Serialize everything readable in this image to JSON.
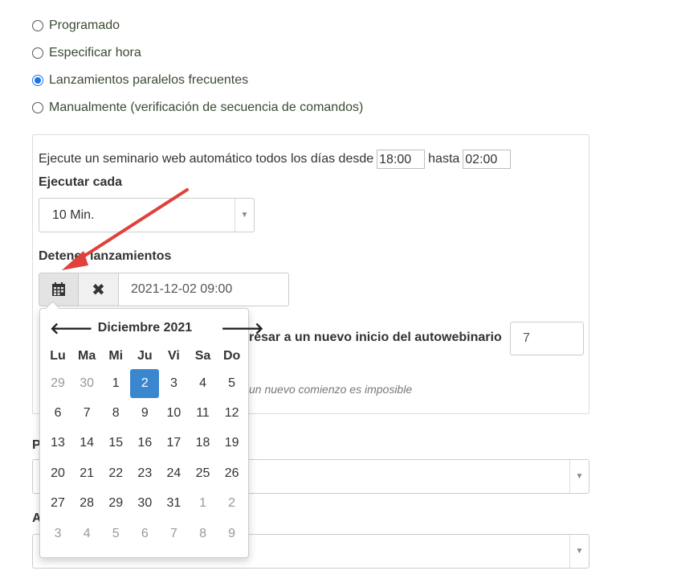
{
  "radios": [
    {
      "label": "Programado",
      "checked": false
    },
    {
      "label": "Especificar hora",
      "checked": false
    },
    {
      "label": "Lanzamientos paralelos frecuentes",
      "checked": true
    },
    {
      "label": "Manualmente (verificación de secuencia de comandos)",
      "checked": false
    }
  ],
  "panel": {
    "line_prefix": "Ejecute un seminario web automático todos los días desde",
    "time_from": "18:00",
    "hasta": "hasta",
    "time_to": "02:00",
    "ejecutar_cada_label": "Ejecutar cada",
    "ejecutar_cada_value": "10 Min.",
    "detener_label": "Detener lanzamientos",
    "date_value": "2021-12-02 09:00",
    "regresar_label": "resar a un nuevo inicio del autowebinario",
    "regresar_value": "7",
    "note": "un nuevo comienzo es imposible"
  },
  "below": {
    "label_p": "P",
    "label_a": "A"
  },
  "calendar": {
    "title": "Diciembre 2021",
    "prev_icon": "arrow-left-icon",
    "next_icon": "arrow-right-icon",
    "dow": [
      "Lu",
      "Ma",
      "Mi",
      "Ju",
      "Vi",
      "Sa",
      "Do"
    ],
    "weeks": [
      [
        {
          "d": "29",
          "m": true
        },
        {
          "d": "30",
          "m": true
        },
        {
          "d": "1"
        },
        {
          "d": "2",
          "sel": true
        },
        {
          "d": "3"
        },
        {
          "d": "4"
        },
        {
          "d": "5"
        }
      ],
      [
        {
          "d": "6"
        },
        {
          "d": "7"
        },
        {
          "d": "8"
        },
        {
          "d": "9"
        },
        {
          "d": "10"
        },
        {
          "d": "11"
        },
        {
          "d": "12"
        }
      ],
      [
        {
          "d": "13"
        },
        {
          "d": "14"
        },
        {
          "d": "15"
        },
        {
          "d": "16"
        },
        {
          "d": "17"
        },
        {
          "d": "18"
        },
        {
          "d": "19"
        }
      ],
      [
        {
          "d": "20"
        },
        {
          "d": "21"
        },
        {
          "d": "22"
        },
        {
          "d": "23"
        },
        {
          "d": "24"
        },
        {
          "d": "25"
        },
        {
          "d": "26"
        }
      ],
      [
        {
          "d": "27"
        },
        {
          "d": "28"
        },
        {
          "d": "29"
        },
        {
          "d": "30"
        },
        {
          "d": "31"
        },
        {
          "d": "1",
          "m": true
        },
        {
          "d": "2",
          "m": true
        }
      ],
      [
        {
          "d": "3",
          "m": true
        },
        {
          "d": "4",
          "m": true
        },
        {
          "d": "5",
          "m": true
        },
        {
          "d": "6",
          "m": true
        },
        {
          "d": "7",
          "m": true
        },
        {
          "d": "8",
          "m": true
        },
        {
          "d": "9",
          "m": true
        }
      ]
    ]
  },
  "colors": {
    "accent": "#1a73e8",
    "selected_day": "#3a87cf",
    "annotation_arrow": "#e0413a",
    "radio_text": "#3a4a34"
  }
}
